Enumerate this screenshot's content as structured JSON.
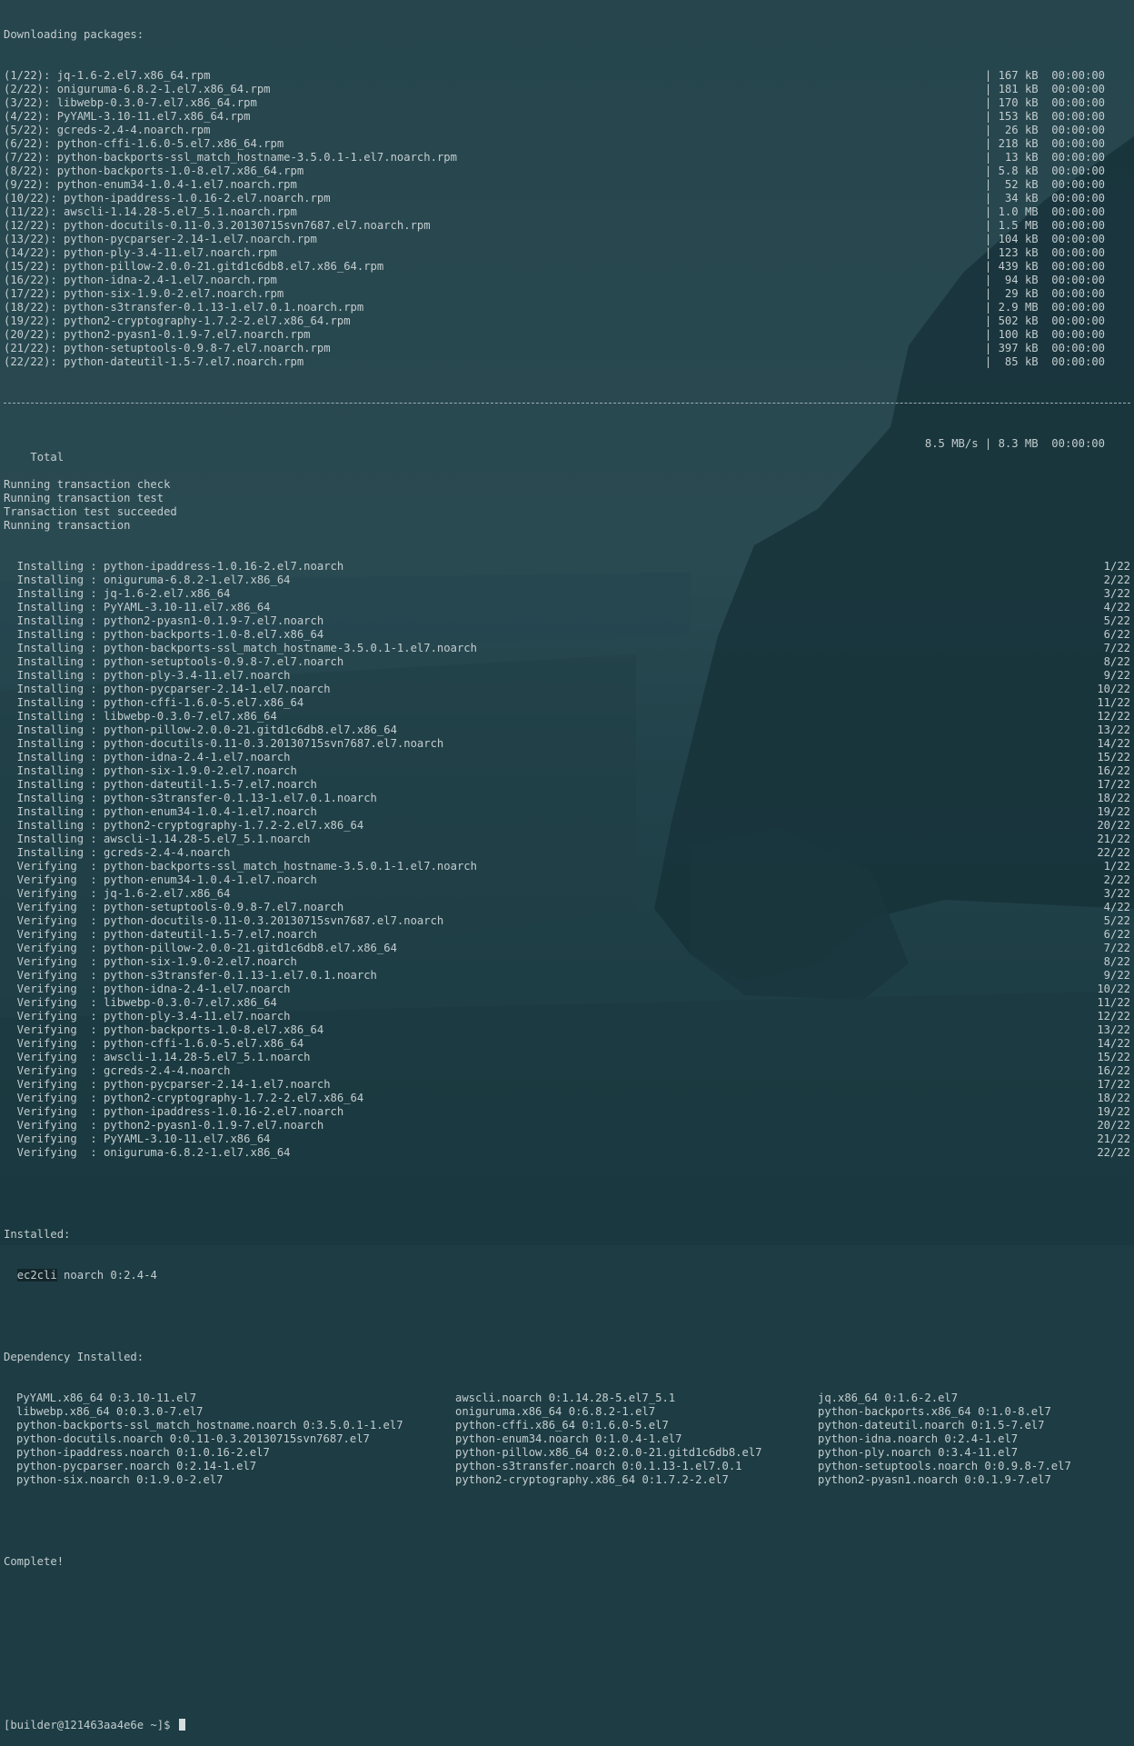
{
  "downloading_header": "Downloading packages:",
  "downloads": [
    {
      "name": "(1/22): jq-1.6-2.el7.x86_64.rpm",
      "info": "| 167 kB  00:00:00"
    },
    {
      "name": "(2/22): oniguruma-6.8.2-1.el7.x86_64.rpm",
      "info": "| 181 kB  00:00:00"
    },
    {
      "name": "(3/22): libwebp-0.3.0-7.el7.x86_64.rpm",
      "info": "| 170 kB  00:00:00"
    },
    {
      "name": "(4/22): PyYAML-3.10-11.el7.x86_64.rpm",
      "info": "| 153 kB  00:00:00"
    },
    {
      "name": "(5/22): gcreds-2.4-4.noarch.rpm",
      "info": "|  26 kB  00:00:00"
    },
    {
      "name": "(6/22): python-cffi-1.6.0-5.el7.x86_64.rpm",
      "info": "| 218 kB  00:00:00"
    },
    {
      "name": "(7/22): python-backports-ssl_match_hostname-3.5.0.1-1.el7.noarch.rpm",
      "info": "|  13 kB  00:00:00"
    },
    {
      "name": "(8/22): python-backports-1.0-8.el7.x86_64.rpm",
      "info": "| 5.8 kB  00:00:00"
    },
    {
      "name": "(9/22): python-enum34-1.0.4-1.el7.noarch.rpm",
      "info": "|  52 kB  00:00:00"
    },
    {
      "name": "(10/22): python-ipaddress-1.0.16-2.el7.noarch.rpm",
      "info": "|  34 kB  00:00:00"
    },
    {
      "name": "(11/22): awscli-1.14.28-5.el7_5.1.noarch.rpm",
      "info": "| 1.0 MB  00:00:00"
    },
    {
      "name": "(12/22): python-docutils-0.11-0.3.20130715svn7687.el7.noarch.rpm",
      "info": "| 1.5 MB  00:00:00"
    },
    {
      "name": "(13/22): python-pycparser-2.14-1.el7.noarch.rpm",
      "info": "| 104 kB  00:00:00"
    },
    {
      "name": "(14/22): python-ply-3.4-11.el7.noarch.rpm",
      "info": "| 123 kB  00:00:00"
    },
    {
      "name": "(15/22): python-pillow-2.0.0-21.gitd1c6db8.el7.x86_64.rpm",
      "info": "| 439 kB  00:00:00"
    },
    {
      "name": "(16/22): python-idna-2.4-1.el7.noarch.rpm",
      "info": "|  94 kB  00:00:00"
    },
    {
      "name": "(17/22): python-six-1.9.0-2.el7.noarch.rpm",
      "info": "|  29 kB  00:00:00"
    },
    {
      "name": "(18/22): python-s3transfer-0.1.13-1.el7.0.1.noarch.rpm",
      "info": "| 2.9 MB  00:00:00"
    },
    {
      "name": "(19/22): python2-cryptography-1.7.2-2.el7.x86_64.rpm",
      "info": "| 502 kB  00:00:00"
    },
    {
      "name": "(20/22): python2-pyasn1-0.1.9-7.el7.noarch.rpm",
      "info": "| 100 kB  00:00:00"
    },
    {
      "name": "(21/22): python-setuptools-0.9.8-7.el7.noarch.rpm",
      "info": "| 397 kB  00:00:00"
    },
    {
      "name": "(22/22): python-dateutil-1.5-7.el7.noarch.rpm",
      "info": "|  85 kB  00:00:00"
    }
  ],
  "total": {
    "label": "Total",
    "info": "8.5 MB/s | 8.3 MB  00:00:00"
  },
  "status_lines": [
    "Running transaction check",
    "Running transaction test",
    "Transaction test succeeded",
    "Running transaction"
  ],
  "steps": [
    {
      "text": "  Installing : python-ipaddress-1.0.16-2.el7.noarch",
      "count": "1/22"
    },
    {
      "text": "  Installing : oniguruma-6.8.2-1.el7.x86_64",
      "count": "2/22"
    },
    {
      "text": "  Installing : jq-1.6-2.el7.x86_64",
      "count": "3/22"
    },
    {
      "text": "  Installing : PyYAML-3.10-11.el7.x86_64",
      "count": "4/22"
    },
    {
      "text": "  Installing : python2-pyasn1-0.1.9-7.el7.noarch",
      "count": "5/22"
    },
    {
      "text": "  Installing : python-backports-1.0-8.el7.x86_64",
      "count": "6/22"
    },
    {
      "text": "  Installing : python-backports-ssl_match_hostname-3.5.0.1-1.el7.noarch",
      "count": "7/22"
    },
    {
      "text": "  Installing : python-setuptools-0.9.8-7.el7.noarch",
      "count": "8/22"
    },
    {
      "text": "  Installing : python-ply-3.4-11.el7.noarch",
      "count": "9/22"
    },
    {
      "text": "  Installing : python-pycparser-2.14-1.el7.noarch",
      "count": "10/22"
    },
    {
      "text": "  Installing : python-cffi-1.6.0-5.el7.x86_64",
      "count": "11/22"
    },
    {
      "text": "  Installing : libwebp-0.3.0-7.el7.x86_64",
      "count": "12/22"
    },
    {
      "text": "  Installing : python-pillow-2.0.0-21.gitd1c6db8.el7.x86_64",
      "count": "13/22"
    },
    {
      "text": "  Installing : python-docutils-0.11-0.3.20130715svn7687.el7.noarch",
      "count": "14/22"
    },
    {
      "text": "  Installing : python-idna-2.4-1.el7.noarch",
      "count": "15/22"
    },
    {
      "text": "  Installing : python-six-1.9.0-2.el7.noarch",
      "count": "16/22"
    },
    {
      "text": "  Installing : python-dateutil-1.5-7.el7.noarch",
      "count": "17/22"
    },
    {
      "text": "  Installing : python-s3transfer-0.1.13-1.el7.0.1.noarch",
      "count": "18/22"
    },
    {
      "text": "  Installing : python-enum34-1.0.4-1.el7.noarch",
      "count": "19/22"
    },
    {
      "text": "  Installing : python2-cryptography-1.7.2-2.el7.x86_64",
      "count": "20/22"
    },
    {
      "text": "  Installing : awscli-1.14.28-5.el7_5.1.noarch",
      "count": "21/22"
    },
    {
      "text": "  Installing : gcreds-2.4-4.noarch",
      "count": "22/22"
    },
    {
      "text": "  Verifying  : python-backports-ssl_match_hostname-3.5.0.1-1.el7.noarch",
      "count": "1/22"
    },
    {
      "text": "  Verifying  : python-enum34-1.0.4-1.el7.noarch",
      "count": "2/22"
    },
    {
      "text": "  Verifying  : jq-1.6-2.el7.x86_64",
      "count": "3/22"
    },
    {
      "text": "  Verifying  : python-setuptools-0.9.8-7.el7.noarch",
      "count": "4/22"
    },
    {
      "text": "  Verifying  : python-docutils-0.11-0.3.20130715svn7687.el7.noarch",
      "count": "5/22"
    },
    {
      "text": "  Verifying  : python-dateutil-1.5-7.el7.noarch",
      "count": "6/22"
    },
    {
      "text": "  Verifying  : python-pillow-2.0.0-21.gitd1c6db8.el7.x86_64",
      "count": "7/22"
    },
    {
      "text": "  Verifying  : python-six-1.9.0-2.el7.noarch",
      "count": "8/22"
    },
    {
      "text": "  Verifying  : python-s3transfer-0.1.13-1.el7.0.1.noarch",
      "count": "9/22"
    },
    {
      "text": "  Verifying  : python-idna-2.4-1.el7.noarch",
      "count": "10/22"
    },
    {
      "text": "  Verifying  : libwebp-0.3.0-7.el7.x86_64",
      "count": "11/22"
    },
    {
      "text": "  Verifying  : python-ply-3.4-11.el7.noarch",
      "count": "12/22"
    },
    {
      "text": "  Verifying  : python-backports-1.0-8.el7.x86_64",
      "count": "13/22"
    },
    {
      "text": "  Verifying  : python-cffi-1.6.0-5.el7.x86_64",
      "count": "14/22"
    },
    {
      "text": "  Verifying  : awscli-1.14.28-5.el7_5.1.noarch",
      "count": "15/22"
    },
    {
      "text": "  Verifying  : gcreds-2.4-4.noarch",
      "count": "16/22"
    },
    {
      "text": "  Verifying  : python-pycparser-2.14-1.el7.noarch",
      "count": "17/22"
    },
    {
      "text": "  Verifying  : python2-cryptography-1.7.2-2.el7.x86_64",
      "count": "18/22"
    },
    {
      "text": "  Verifying  : python-ipaddress-1.0.16-2.el7.noarch",
      "count": "19/22"
    },
    {
      "text": "  Verifying  : python2-pyasn1-0.1.9-7.el7.noarch",
      "count": "20/22"
    },
    {
      "text": "  Verifying  : PyYAML-3.10-11.el7.x86_64",
      "count": "21/22"
    },
    {
      "text": "  Verifying  : oniguruma-6.8.2-1.el7.x86_64",
      "count": "22/22"
    }
  ],
  "installed": {
    "label": "Installed:",
    "package": "ec2cli",
    "rest": " noarch 0:2.4-4"
  },
  "dependency": {
    "label": "Dependency Installed:",
    "rows": [
      [
        "PyYAML.x86_64 0:3.10-11.el7",
        "awscli.noarch 0:1.14.28-5.el7_5.1",
        "jq.x86_64 0:1.6-2.el7"
      ],
      [
        "libwebp.x86_64 0:0.3.0-7.el7",
        "oniguruma.x86_64 0:6.8.2-1.el7",
        "python-backports.x86_64 0:1.0-8.el7"
      ],
      [
        "python-backports-ssl_match_hostname.noarch 0:3.5.0.1-1.el7",
        "python-cffi.x86_64 0:1.6.0-5.el7",
        "python-dateutil.noarch 0:1.5-7.el7"
      ],
      [
        "python-docutils.noarch 0:0.11-0.3.20130715svn7687.el7",
        "python-enum34.noarch 0:1.0.4-1.el7",
        "python-idna.noarch 0:2.4-1.el7"
      ],
      [
        "python-ipaddress.noarch 0:1.0.16-2.el7",
        "python-pillow.x86_64 0:2.0.0-21.gitd1c6db8.el7",
        "python-ply.noarch 0:3.4-11.el7"
      ],
      [
        "python-pycparser.noarch 0:2.14-1.el7",
        "python-s3transfer.noarch 0:0.1.13-1.el7.0.1",
        "python-setuptools.noarch 0:0.9.8-7.el7"
      ],
      [
        "python-six.noarch 0:1.9.0-2.el7",
        "python2-cryptography.x86_64 0:1.7.2-2.el7",
        "python2-pyasn1.noarch 0:0.1.9-7.el7"
      ]
    ]
  },
  "complete": "Complete!",
  "prompt": "[builder@121463aa4e6e ~]$",
  "colors": {
    "background": "#1d3c44",
    "text": "#c3cdcf",
    "rock": "#17323a"
  }
}
